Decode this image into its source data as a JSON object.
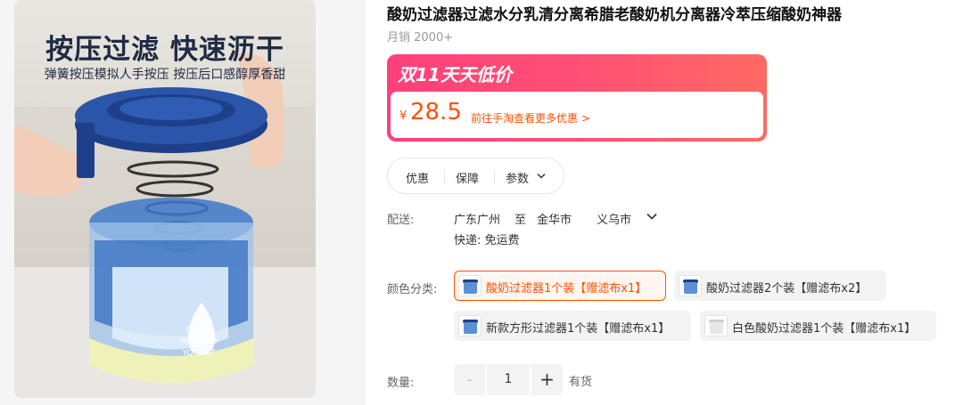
{
  "image": {
    "headline": "按压过滤 快速沥干",
    "subheadline": "弹簧按压模拟人手按压 按压后口感醇厚香甜",
    "cup_text": [
      "QUICK",
      "MIZUKIRI",
      "YOGURT"
    ]
  },
  "product": {
    "title": "酸奶过滤器过滤水分乳清分离希腊老酸奶机分离器冷萃压缩酸奶神器",
    "monthly_sales": "月销 2000+"
  },
  "promo": {
    "banner_title": "双11天天低价",
    "currency": "¥",
    "price": "28.5",
    "link": "前往手淘查看更多优惠 >"
  },
  "tabs": [
    "优惠",
    "保障",
    "参数"
  ],
  "shipping": {
    "label": "配送:",
    "from": "广东广州",
    "to_word": "至",
    "to_city": "金华市",
    "to_district": "义乌市",
    "express": "快递: 免运费"
  },
  "sku": {
    "label": "颜色分类:",
    "options": [
      {
        "label": "酸奶过滤器1个装【赠滤布x1】",
        "selected": true
      },
      {
        "label": "酸奶过滤器2个装【赠滤布x2】",
        "selected": false
      },
      {
        "label": "新款方形过滤器1个装【赠滤布x1】",
        "selected": false
      },
      {
        "label": "白色酸奶过滤器1个装【赠滤布x1】",
        "selected": false
      }
    ]
  },
  "quantity": {
    "label": "数量:",
    "minus": "-",
    "value": "1",
    "plus": "+",
    "stock": "有货"
  },
  "colors": {
    "accent": "#ff5000",
    "promo_pink": "#ff3f7a",
    "lid_blue": "#1e3f8a"
  }
}
